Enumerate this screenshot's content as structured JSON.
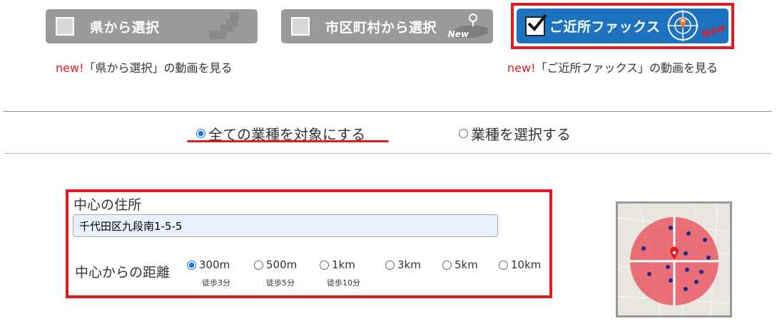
{
  "buttons": {
    "prefecture": {
      "label": "県から選択"
    },
    "city": {
      "label": "市区町村から選択",
      "badge": "New"
    },
    "nearby_fax": {
      "label": "ご近所ファックス",
      "badge": "New"
    }
  },
  "video_links": {
    "prefecture": {
      "prefix": "new!",
      "text": "「県から選択」の動画を見る"
    },
    "nearby_fax": {
      "prefix": "new!",
      "text": "「ご近所ファックス」の動画を見る"
    }
  },
  "industry": {
    "all_label": "全ての業種を対象にする",
    "select_label": "業種を選択する",
    "selected": "all"
  },
  "address": {
    "label": "中心の住所",
    "value": "千代田区九段南1-5-5"
  },
  "distance": {
    "label": "中心からの距離",
    "options": [
      {
        "label": "300m",
        "sub": "徒歩3分",
        "selected": true
      },
      {
        "label": "500m",
        "sub": "徒歩5分",
        "selected": false
      },
      {
        "label": "1km",
        "sub": "徒歩10分",
        "selected": false
      },
      {
        "label": "3km",
        "selected": false
      },
      {
        "label": "5km",
        "selected": false
      },
      {
        "label": "10km",
        "selected": false
      }
    ]
  },
  "colors": {
    "accent_red": "#e21b23",
    "fax_blue": "#1e73c0",
    "gray_button": "#9a9a9a",
    "radio_blue": "#1a73e8"
  },
  "icons": [
    "checkbox-icon",
    "japan-map-icon",
    "map-pin-icon",
    "checkmark-icon",
    "radar-target-icon",
    "radio-icon"
  ]
}
